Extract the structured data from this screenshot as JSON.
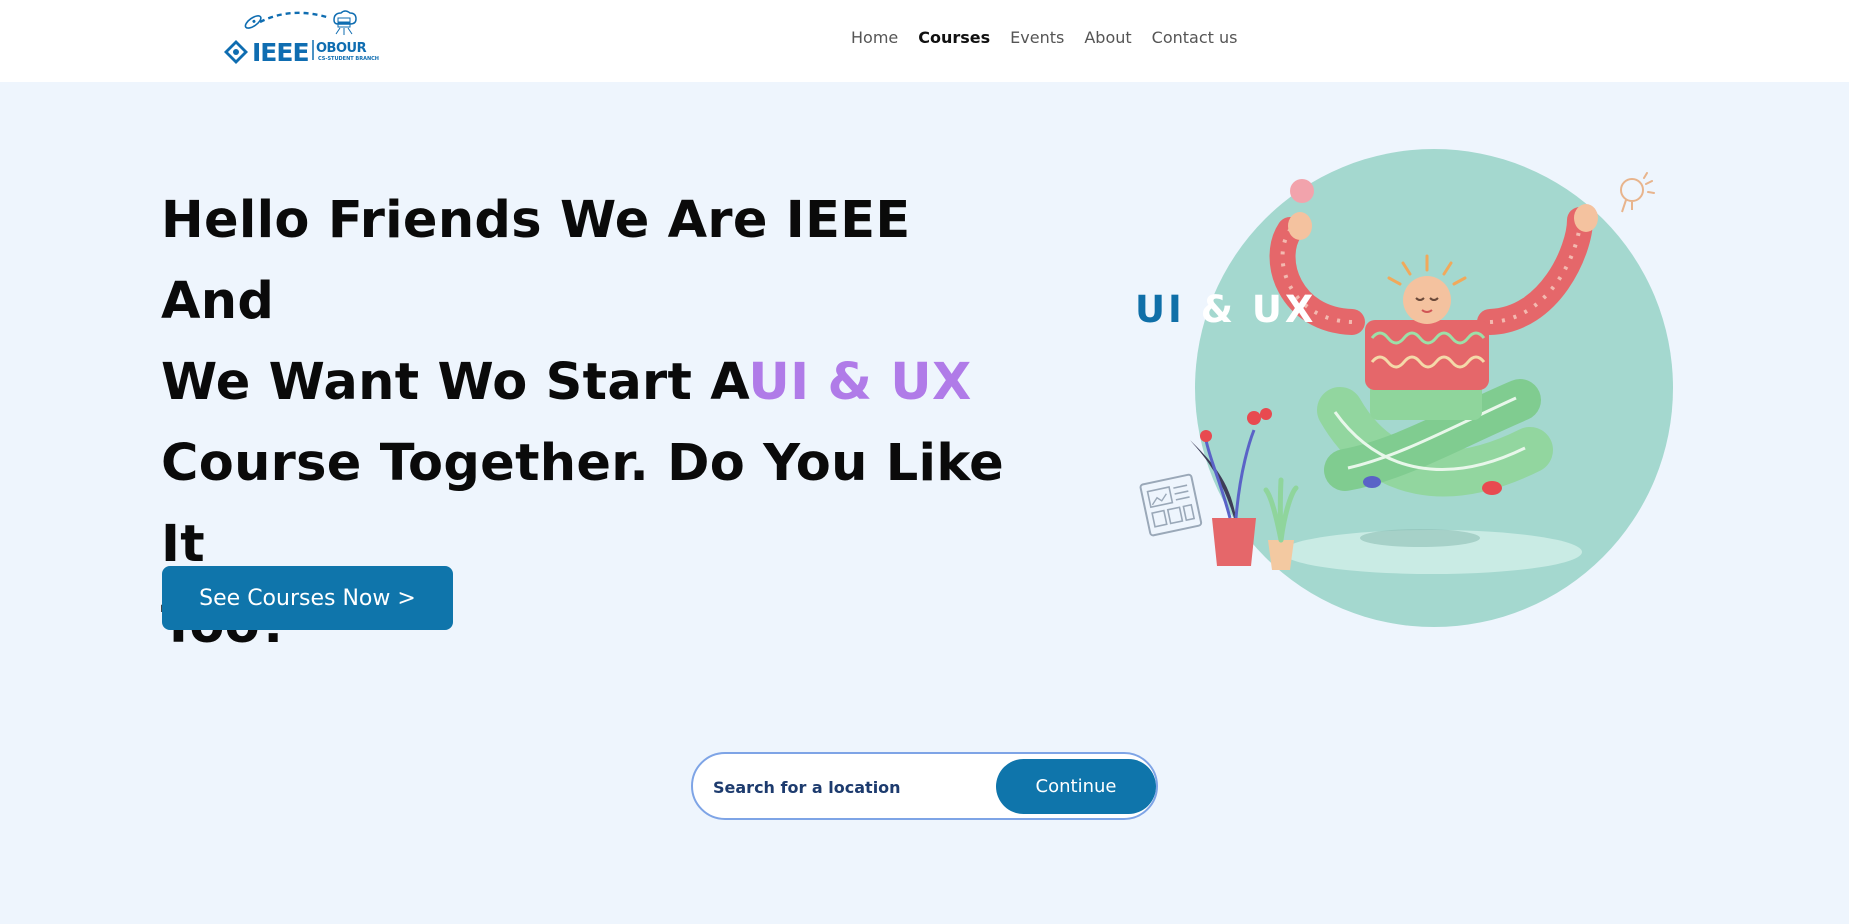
{
  "navbar": {
    "logo": {
      "text": "IEEE",
      "obour": "OBOUR",
      "subtitle": "CS-STUDENT BRANCH"
    },
    "links": [
      {
        "label": "Home",
        "active": false
      },
      {
        "label": "Courses",
        "active": true
      },
      {
        "label": "Events",
        "active": false
      },
      {
        "label": "About",
        "active": false
      },
      {
        "label": "Contact us",
        "active": false
      }
    ]
  },
  "hero": {
    "title_line1": "Hello Friends We Are IEEE And",
    "title_line2_prefix": "We Want Wo Start A",
    "title_line2_accent": "UI & UX",
    "title_line3": "Course Together. Do You Like It",
    "title_line4": "Too?",
    "cta_label": "See Courses Now >"
  },
  "illustration": {
    "overlay_ui": "UI",
    "overlay_rest": "& UX"
  },
  "search": {
    "placeholder": "Search for a location",
    "button_label": "Continue"
  },
  "colors": {
    "background": "#eef5fd",
    "primary": "#0f75ab",
    "accent_purple": "#b07be8",
    "circle": "#a4d8cf",
    "logo_blue": "#0f6db1"
  }
}
